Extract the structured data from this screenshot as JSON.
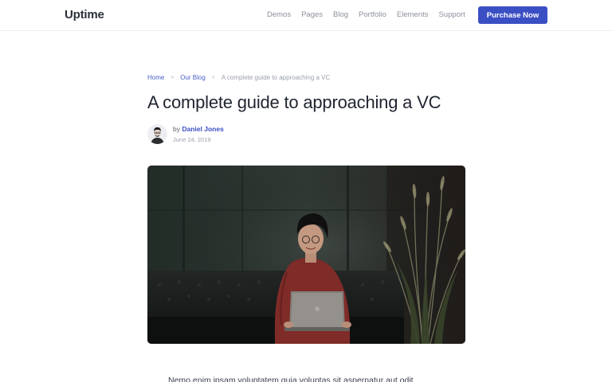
{
  "brand": {
    "name": "Uptime"
  },
  "nav": {
    "links": [
      "Demos",
      "Pages",
      "Blog",
      "Portfolio",
      "Elements",
      "Support"
    ],
    "cta_label": "Purchase Now"
  },
  "breadcrumb": {
    "home": "Home",
    "section": "Our Blog",
    "separator": "»",
    "current": "A complete guide to approaching a VC"
  },
  "post": {
    "title": "A complete guide to approaching a VC",
    "by_prefix": "by",
    "author": "Daniel Jones",
    "date": "June 24, 2019",
    "excerpt": "Nemo enim ipsam voluptatem quia voluptas sit aspernatur aut odit"
  },
  "colors": {
    "accent": "#3b4fc4",
    "link": "#4a60c8",
    "muted": "#9aa0ab"
  },
  "icons": {
    "avatar": "person-avatar-illustration",
    "hero": "photo-person-with-laptop-on-leather-sofa"
  }
}
